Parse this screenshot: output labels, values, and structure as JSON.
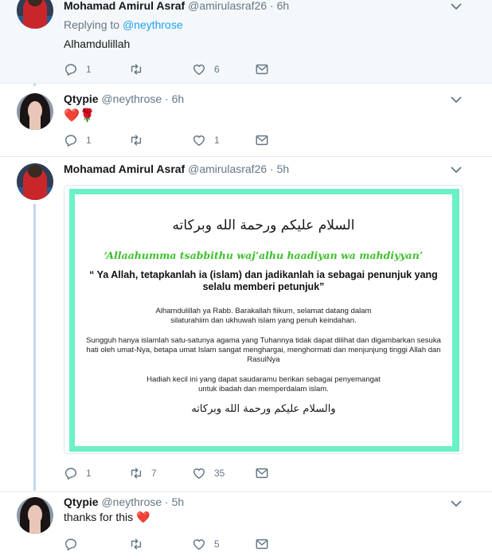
{
  "tweets": [
    {
      "name": "Mohamad Amirul Asraf",
      "handle": "@amirulasraf26 · 6h",
      "replying_prefix": "Replying to",
      "replying_handle": "@neythrose",
      "text": "Alhamdulillah",
      "reply_count": "1",
      "retweet_count": "",
      "like_count": "6"
    },
    {
      "name": "Qtypie",
      "handle": "@neythrose · 6h",
      "text": "❤️🌹",
      "reply_count": "1",
      "retweet_count": "",
      "like_count": "1"
    },
    {
      "name": "Mohamad Amirul Asraf",
      "handle": "@amirulasraf26 · 5h",
      "reply_count": "1",
      "retweet_count": "7",
      "like_count": "35",
      "card": {
        "arabic_top": "السلام عليكم ورحمة الله وبركاته",
        "line1": "‘Allaahumma tsabbithu waj’alhu haadiyan wa mahdiyyan’",
        "line2": "“ Ya Allah, tetapkanlah ia (islam) dan jadikanlah ia sebagai penunjuk yang selalu memberi petunjuk”",
        "para1": "Alhamdulillah ya Rabb. Barakallah fiikum, selamat datang dalam silaturahiim dan ukhuwah islam yang penuh keindahan.",
        "para2": "Sungguh hanya islamlah satu-satunya agama yang Tuhannya tidak dapat dilihat dan digambarkan sesuka hati oleh umat-Nya, betapa umat Islam sangat menghargai, menghormati dan menjunjung tinggi Allah dan RasulNya",
        "para3": "Hadiah kecil ini yang dapat saudaramu berikan sebagai penyemangat untuk ibadah dan memperdalam islam.",
        "arabic_bottom": "والسلام عليكم ورحمة الله وبركاته"
      }
    },
    {
      "name": "Qtypie",
      "handle": "@neythrose · 5h",
      "text": "thanks for this ❤️",
      "reply_count": "",
      "retweet_count": "",
      "like_count": "5"
    }
  ],
  "colors": {
    "link": "#1da1f2",
    "secondary_text": "#657786",
    "thread_line": "#c4d6ec",
    "highlight_bg": "#f5f8fa",
    "card_border": "#6cf0c6",
    "card_green_text": "#3cc12a"
  },
  "icons": [
    "reply-icon",
    "retweet-icon",
    "like-icon",
    "message-icon",
    "chevron-down-icon"
  ]
}
